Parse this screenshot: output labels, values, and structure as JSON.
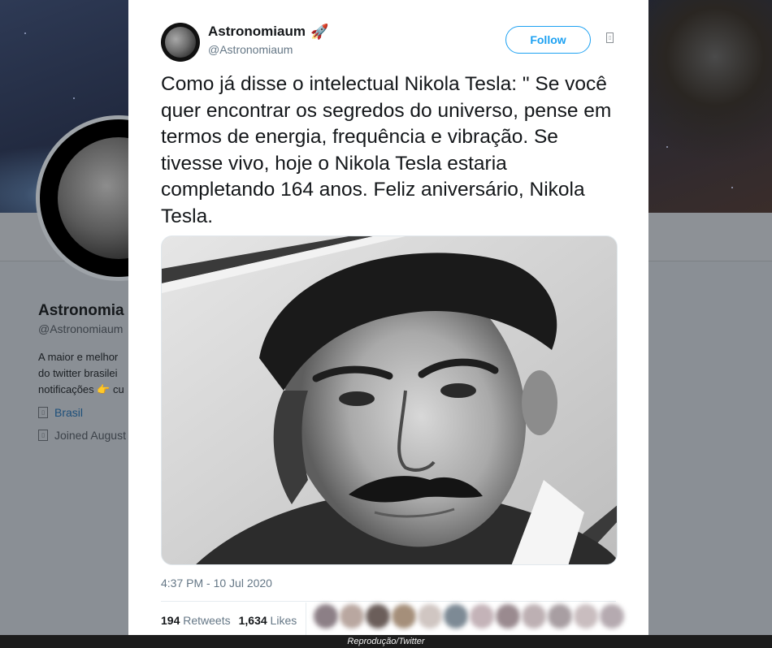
{
  "profile": {
    "name": "Astronomia",
    "handle": "@Astronomiaum",
    "bio_lines": [
      "A maior e melhor",
      "do twitter brasilei",
      "notificações 👉 cu"
    ],
    "location": "Brasil",
    "joined": "Joined August"
  },
  "tweet": {
    "author_name": "Astronomiaum",
    "author_emoji": "🚀",
    "author_handle": "@Astronomiaum",
    "follow_label": "Follow",
    "text": "Como já disse o intelectual Nikola Tesla: \" Se você quer encontrar os segredos do universo, pense em termos de energia, frequência e vibração. Se tivesse vivo, hoje o Nikola Tesla estaria completando 164 anos. Feliz aniversário, Nikola Tesla.",
    "timestamp": "4:37 PM - 10 Jul 2020",
    "retweets_count": "194",
    "retweets_label": "Retweets",
    "likes_count": "1,634",
    "likes_label": "Likes"
  },
  "icons": {
    "caret": "chevron-down-icon",
    "location": "location-pin-icon",
    "calendar": "calendar-icon"
  },
  "colors": {
    "accent": "#1da1f2",
    "text": "#14171a",
    "secondary": "#657786"
  },
  "caption": "Reprodução/Twitter"
}
